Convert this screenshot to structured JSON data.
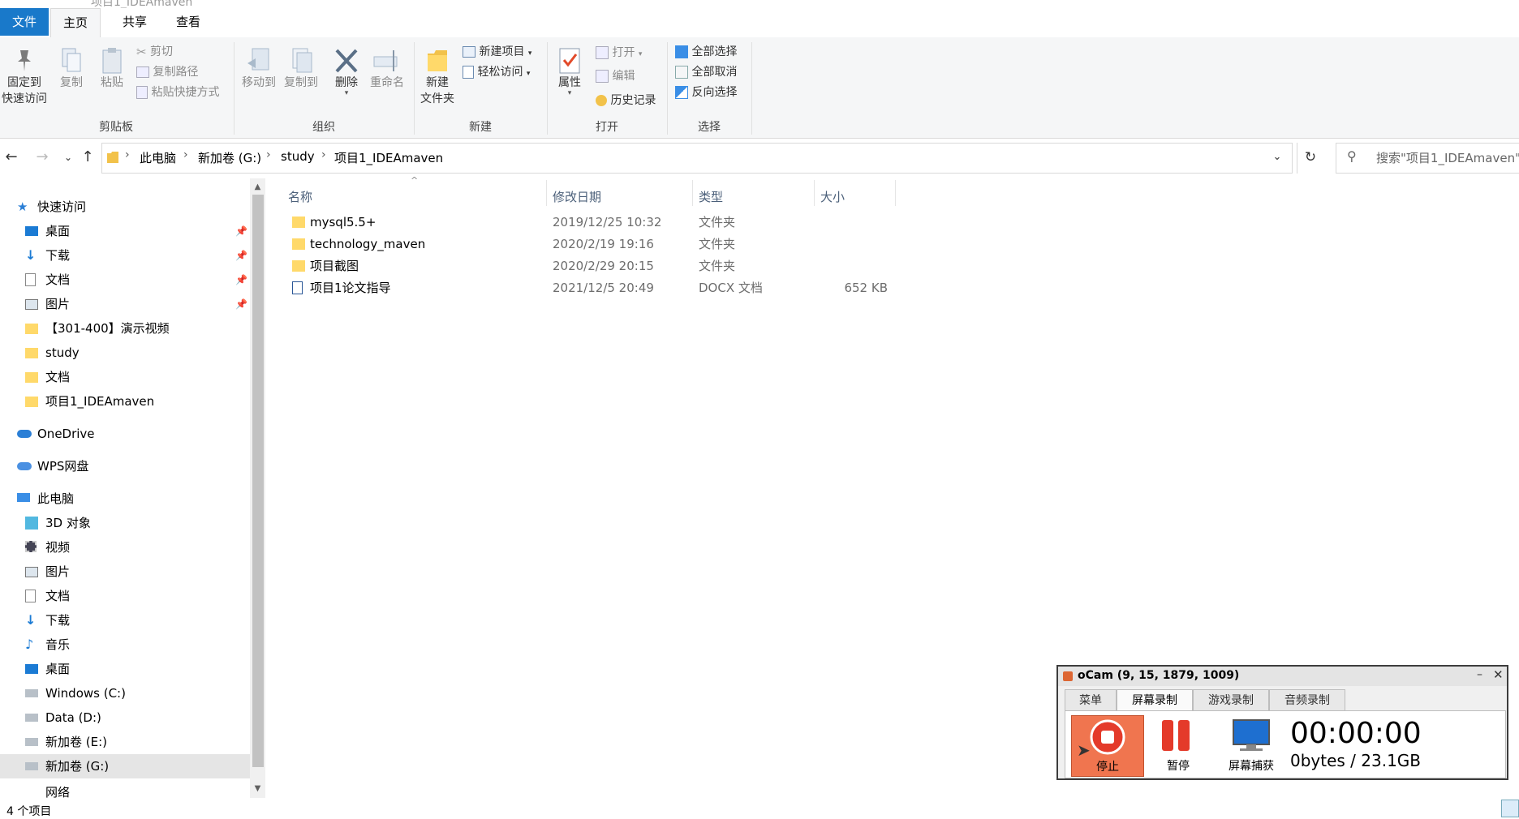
{
  "window": {
    "title": "项目1_IDEAmaven"
  },
  "ribbon_tabs": {
    "file": "文件",
    "home": "主页",
    "share": "共享",
    "view": "查看"
  },
  "clipboard": {
    "pin_quick_access": "固定到\n快速访问",
    "pin_line1": "固定到",
    "pin_line2": "快速访问",
    "copy": "复制",
    "paste": "粘贴",
    "cut": "剪切",
    "copy_path": "复制路径",
    "paste_shortcut": "粘贴快捷方式",
    "group_label": "剪贴板"
  },
  "organize": {
    "move_to": "移动到",
    "copy_to": "复制到",
    "delete": "删除",
    "rename": "重命名",
    "group_label": "组织"
  },
  "new": {
    "new_folder_line1": "新建",
    "new_folder_line2": "文件夹",
    "new_item": "新建项目",
    "easy_access": "轻松访问",
    "group_label": "新建"
  },
  "open": {
    "properties": "属性",
    "open": "打开",
    "edit": "编辑",
    "history": "历史记录",
    "group_label": "打开"
  },
  "select": {
    "select_all": "全部选择",
    "select_none": "全部取消",
    "invert": "反向选择",
    "group_label": "选择"
  },
  "breadcrumb": [
    "此电脑",
    "新加卷 (G:)",
    "study",
    "项目1_IDEAmaven"
  ],
  "search": {
    "placeholder": "搜索\"项目1_IDEAmaven\""
  },
  "nav_pane": {
    "quick_access": "快速访问",
    "quick_items": [
      "桌面",
      "下载",
      "文档",
      "图片",
      "【301-400】演示视频",
      "study",
      "文档",
      "项目1_IDEAmaven"
    ],
    "onedrive": "OneDrive",
    "wps": "WPS网盘",
    "this_pc": "此电脑",
    "pc_items": [
      "3D 对象",
      "视频",
      "图片",
      "文档",
      "下载",
      "音乐",
      "桌面",
      "Windows (C:)",
      "Data (D:)",
      "新加卷 (E:)",
      "新加卷 (G:)"
    ],
    "network": "网络"
  },
  "columns": {
    "name": "名称",
    "date": "修改日期",
    "type": "类型",
    "size": "大小"
  },
  "files": [
    {
      "name": "mysql5.5+",
      "date": "2019/12/25 10:32",
      "type": "文件夹",
      "size": ""
    },
    {
      "name": "technology_maven",
      "date": "2020/2/19 19:16",
      "type": "文件夹",
      "size": ""
    },
    {
      "name": "项目截图",
      "date": "2020/2/29 20:15",
      "type": "文件夹",
      "size": ""
    },
    {
      "name": "项目1论文指导",
      "date": "2021/12/5 20:49",
      "type": "DOCX 文档",
      "size": "652 KB"
    }
  ],
  "status": {
    "count": "4 个项目"
  },
  "ocam": {
    "title": "oCam (9, 15, 1879, 1009)",
    "tabs": [
      "菜单",
      "屏幕录制",
      "游戏录制",
      "音频录制"
    ],
    "stop": "停止",
    "pause": "暂停",
    "capture": "屏幕捕获",
    "timer": "00:00:00",
    "bytes": "0bytes / 23.1GB"
  },
  "colors": {
    "accent": "#1979ca",
    "selection": "#cce8ff",
    "stop_button": "#f0754f"
  }
}
